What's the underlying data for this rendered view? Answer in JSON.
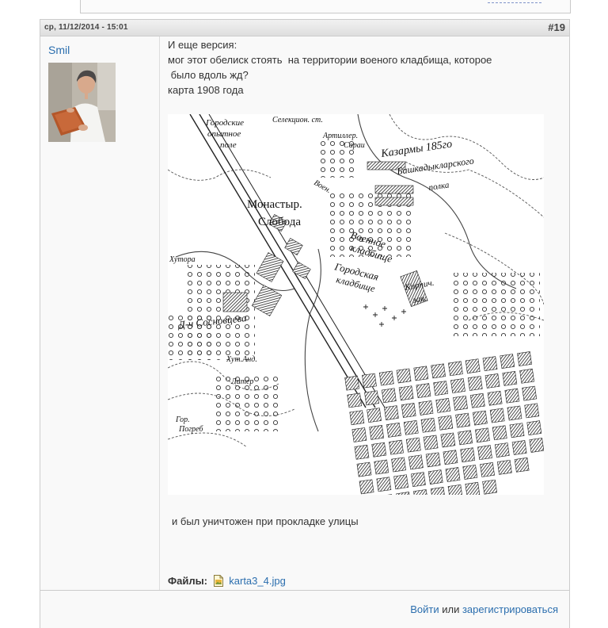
{
  "post": {
    "date": "ср, 11/12/2014 - 15:01",
    "number": "#19",
    "author": "Smil",
    "lines": [
      "И еще версия:",
      "мог этот обелиск стоять  на территории военого кладбища, которое",
      " было вдоль жд?",
      "карта 1908 года"
    ],
    "after_image": "и был уничтожен при прокладке улицы",
    "files_label": "Файлы:",
    "file_name": "karta3_4.jpg"
  },
  "map": {
    "labels": [
      "Городские",
      "опытное",
      "поле",
      "Селекцион. ст.",
      "Артиллер.",
      "Сараи",
      "Казармы 185го",
      "Башкадыкларского",
      "полка",
      "Монастыр.",
      "Слобода",
      "Воен.",
      "Военное",
      "кладбище",
      "Городская",
      "кладбище",
      "Кирпич.",
      "зав.",
      "Хутора",
      "Д-ч Сосновцева",
      "Хут.Анд.",
      "Литер",
      "Гор.",
      "Погреб"
    ]
  },
  "footer": {
    "login": "Войти",
    "or": "или",
    "register": "зарегистрироваться"
  },
  "icons": {
    "file": "image-file-icon",
    "avatar": "user-avatar"
  },
  "colors": {
    "link": "#2b6eae",
    "border": "#cccccc",
    "header_bg": "#e5e5e5",
    "post_bg": "#f9f9f9"
  }
}
